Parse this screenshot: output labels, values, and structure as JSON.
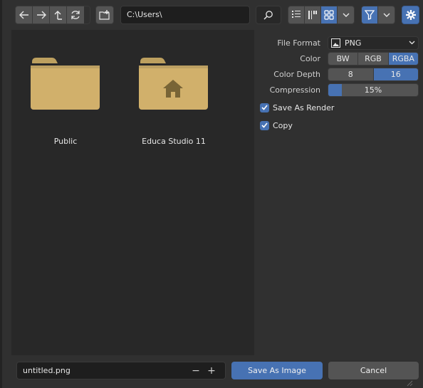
{
  "toolbar": {
    "path": "C:\\Users\\",
    "icons": [
      "back-arrow-icon",
      "forward-arrow-icon",
      "parent-dir-icon",
      "refresh-icon",
      "new-folder-icon",
      "search-icon",
      "vertical-list-icon",
      "horizontal-list-icon",
      "thumbnails-icon",
      "chevron-down-icon",
      "filter-icon",
      "gear-icon"
    ],
    "accent": "#4772b3"
  },
  "browser": {
    "items": [
      {
        "label": "Public",
        "icon": "folder-icon"
      },
      {
        "label": "Educa Studio 11",
        "icon": "home-folder-icon"
      }
    ],
    "folder_color": "#d1b06b"
  },
  "options": {
    "file_format": {
      "label": "File Format",
      "value": "PNG"
    },
    "color": {
      "label": "Color",
      "options": [
        "BW",
        "RGB",
        "RGBA"
      ],
      "selected": "RGBA"
    },
    "color_depth": {
      "label": "Color Depth",
      "options": [
        "8",
        "16"
      ],
      "selected": "16"
    },
    "compression": {
      "label": "Compression",
      "value": "15%",
      "fraction": 0.15
    },
    "save_as_render": {
      "label": "Save As Render",
      "checked": true
    },
    "copy": {
      "label": "Copy",
      "checked": true
    }
  },
  "footer": {
    "filename": "untitled.png",
    "minus": "−",
    "plus": "+",
    "save_label": "Save As Image",
    "cancel_label": "Cancel"
  }
}
